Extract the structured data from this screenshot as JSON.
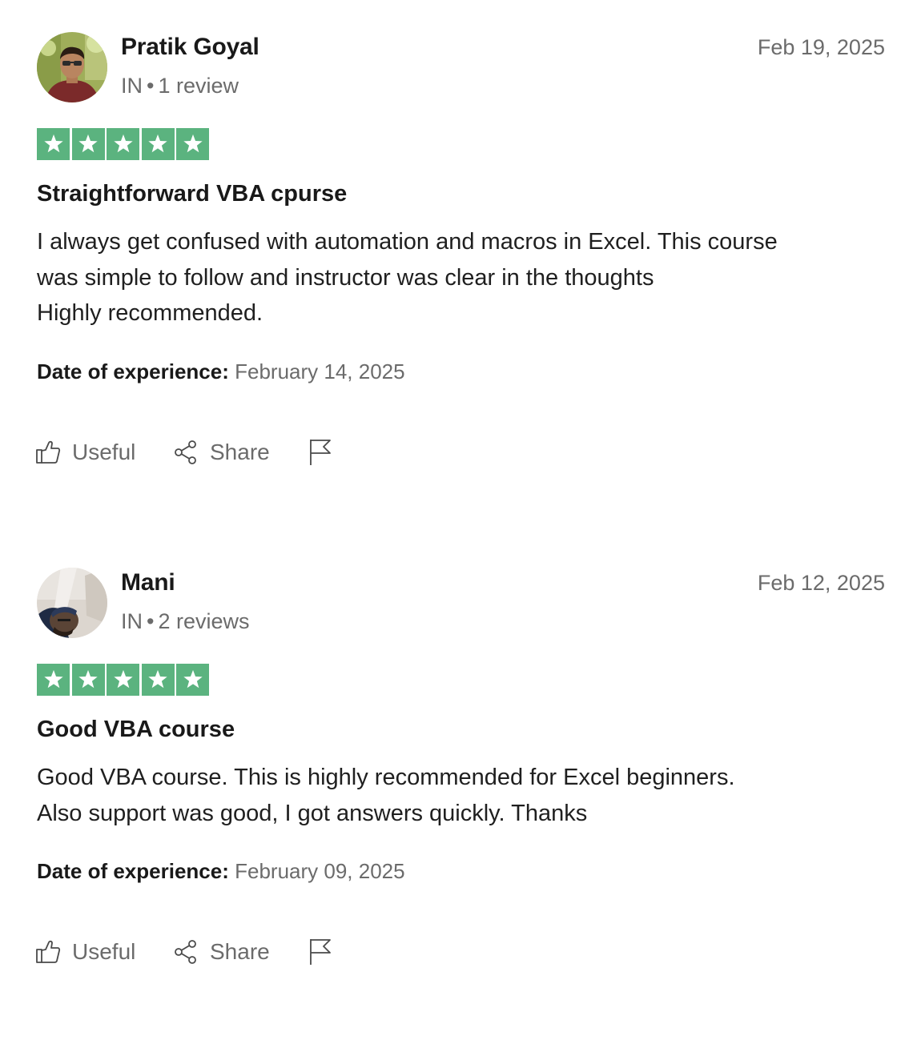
{
  "colors": {
    "star_green": "#5bb37f",
    "text_primary": "#191919",
    "text_secondary": "#6b6b6b"
  },
  "reviews": [
    {
      "reviewer": {
        "name": "Pratik Goyal",
        "country": "IN",
        "separator": "•",
        "review_count": "1 review"
      },
      "date": "Feb 19, 2025",
      "rating": 5,
      "title": "Straightforward VBA cpurse",
      "body_lines": [
        "I always get confused with automation and macros in Excel. This course",
        "was simple to follow and instructor was clear in the thoughts",
        "Highly recommended."
      ],
      "experience": {
        "label": "Date of experience:",
        "value": "February 14, 2025"
      },
      "actions": {
        "useful": "Useful",
        "share": "Share"
      },
      "icons": {
        "useful": "thumbs-up-icon",
        "share": "share-icon",
        "flag": "flag-icon",
        "star": "star-icon"
      }
    },
    {
      "reviewer": {
        "name": "Mani",
        "country": "IN",
        "separator": "•",
        "review_count": "2 reviews"
      },
      "date": "Feb 12, 2025",
      "rating": 5,
      "title": "Good VBA course",
      "body_lines": [
        "Good VBA course. This is highly recommended for Excel beginners.",
        "Also support was good, I got answers quickly. Thanks"
      ],
      "experience": {
        "label": "Date of experience:",
        "value": "February 09, 2025"
      },
      "actions": {
        "useful": "Useful",
        "share": "Share"
      },
      "icons": {
        "useful": "thumbs-up-icon",
        "share": "share-icon",
        "flag": "flag-icon",
        "star": "star-icon"
      }
    }
  ]
}
